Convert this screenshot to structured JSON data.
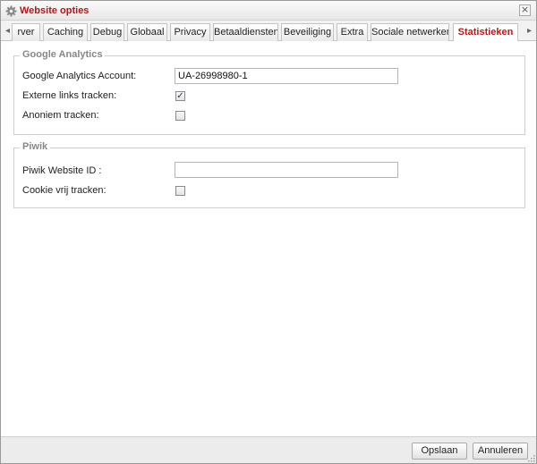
{
  "window": {
    "title": "Website opties",
    "close_glyph": "×"
  },
  "tabs": {
    "scroll_left_glyph": "◂",
    "scroll_right_glyph": "▸",
    "items": [
      {
        "label": "rver"
      },
      {
        "label": "Caching"
      },
      {
        "label": "Debug"
      },
      {
        "label": "Globaal"
      },
      {
        "label": "Privacy"
      },
      {
        "label": "Betaaldiensten"
      },
      {
        "label": "Beveiliging"
      },
      {
        "label": "Extra"
      },
      {
        "label": "Sociale netwerken"
      },
      {
        "label": "Statistieken",
        "active": true
      }
    ]
  },
  "google_analytics": {
    "legend": "Google Analytics",
    "account_label": "Google Analytics Account:",
    "account_value": "UA-26998980-1",
    "external_links_label": "Externe links tracken:",
    "external_links_checked": true,
    "anonymous_label": "Anoniem tracken:",
    "anonymous_checked": false
  },
  "piwik": {
    "legend": "Piwik",
    "website_id_label": "Piwik Website ID :",
    "website_id_value": "",
    "cookie_free_label": "Cookie vrij tracken:",
    "cookie_free_checked": false
  },
  "footer": {
    "save_label": "Opslaan",
    "cancel_label": "Annuleren"
  },
  "colors": {
    "title_red": "#b01818",
    "active_tab_red": "#c01818",
    "legend_grey": "#888888"
  },
  "icons": {
    "title_icon": "gear-icon",
    "checkmark": "✓"
  }
}
